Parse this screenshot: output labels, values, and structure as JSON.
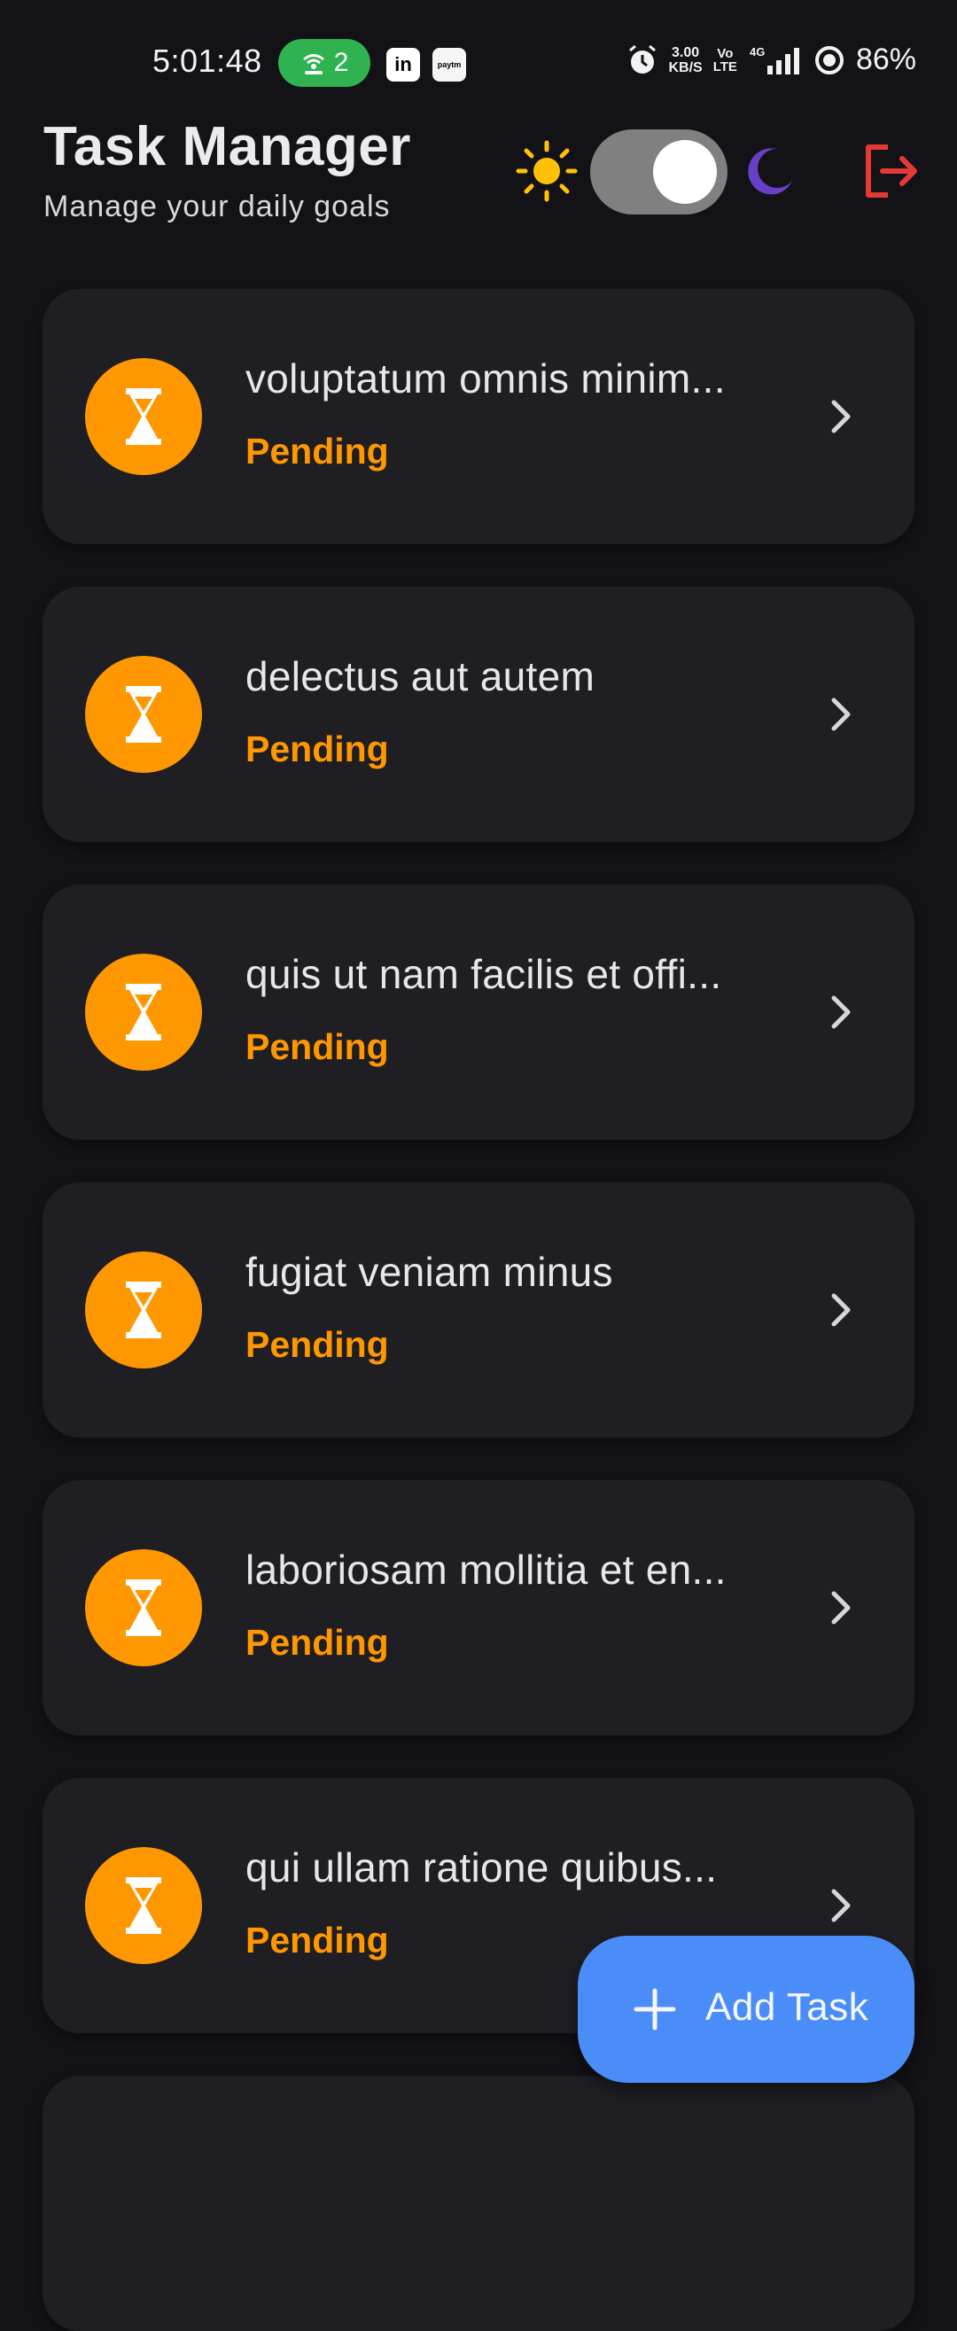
{
  "status_bar": {
    "time": "5:01:48",
    "hotspot_count": "2",
    "app_icons": [
      "in",
      "paytm"
    ],
    "speed_value": "3.00",
    "speed_unit": "KB/S",
    "volte_top": "Vo",
    "volte_bottom": "LTE",
    "network": "4G",
    "battery": "86%",
    "icons": [
      "hotspot-icon",
      "linkedin-icon",
      "paytm-icon",
      "alarm-icon",
      "signal-icon",
      "battery-ring-icon"
    ]
  },
  "header": {
    "title": "Task Manager",
    "subtitle": "Manage your daily goals",
    "theme_toggle_on": true,
    "icons": [
      "sun-icon",
      "moon-icon",
      "logout-icon"
    ]
  },
  "tasks": [
    {
      "title": "voluptatum omnis minim...",
      "status": "Pending"
    },
    {
      "title": "delectus aut autem",
      "status": "Pending"
    },
    {
      "title": "quis ut nam facilis et offi...",
      "status": "Pending"
    },
    {
      "title": "fugiat veniam minus",
      "status": "Pending"
    },
    {
      "title": "laboriosam mollitia et en...",
      "status": "Pending"
    },
    {
      "title": "qui ullam ratione quibus...",
      "status": "Pending"
    },
    {
      "title": "",
      "status": ""
    }
  ],
  "fab": {
    "label": "Add Task",
    "icon": "plus-icon"
  },
  "colors": {
    "background": "#131216",
    "card": "#1F1E23",
    "pending": "#FF9800",
    "accent": "#4A8DF8",
    "logout": "#E53935",
    "moon": "#6A3FC8",
    "sun": "#FFC107",
    "hotspot": "#2FB351"
  }
}
